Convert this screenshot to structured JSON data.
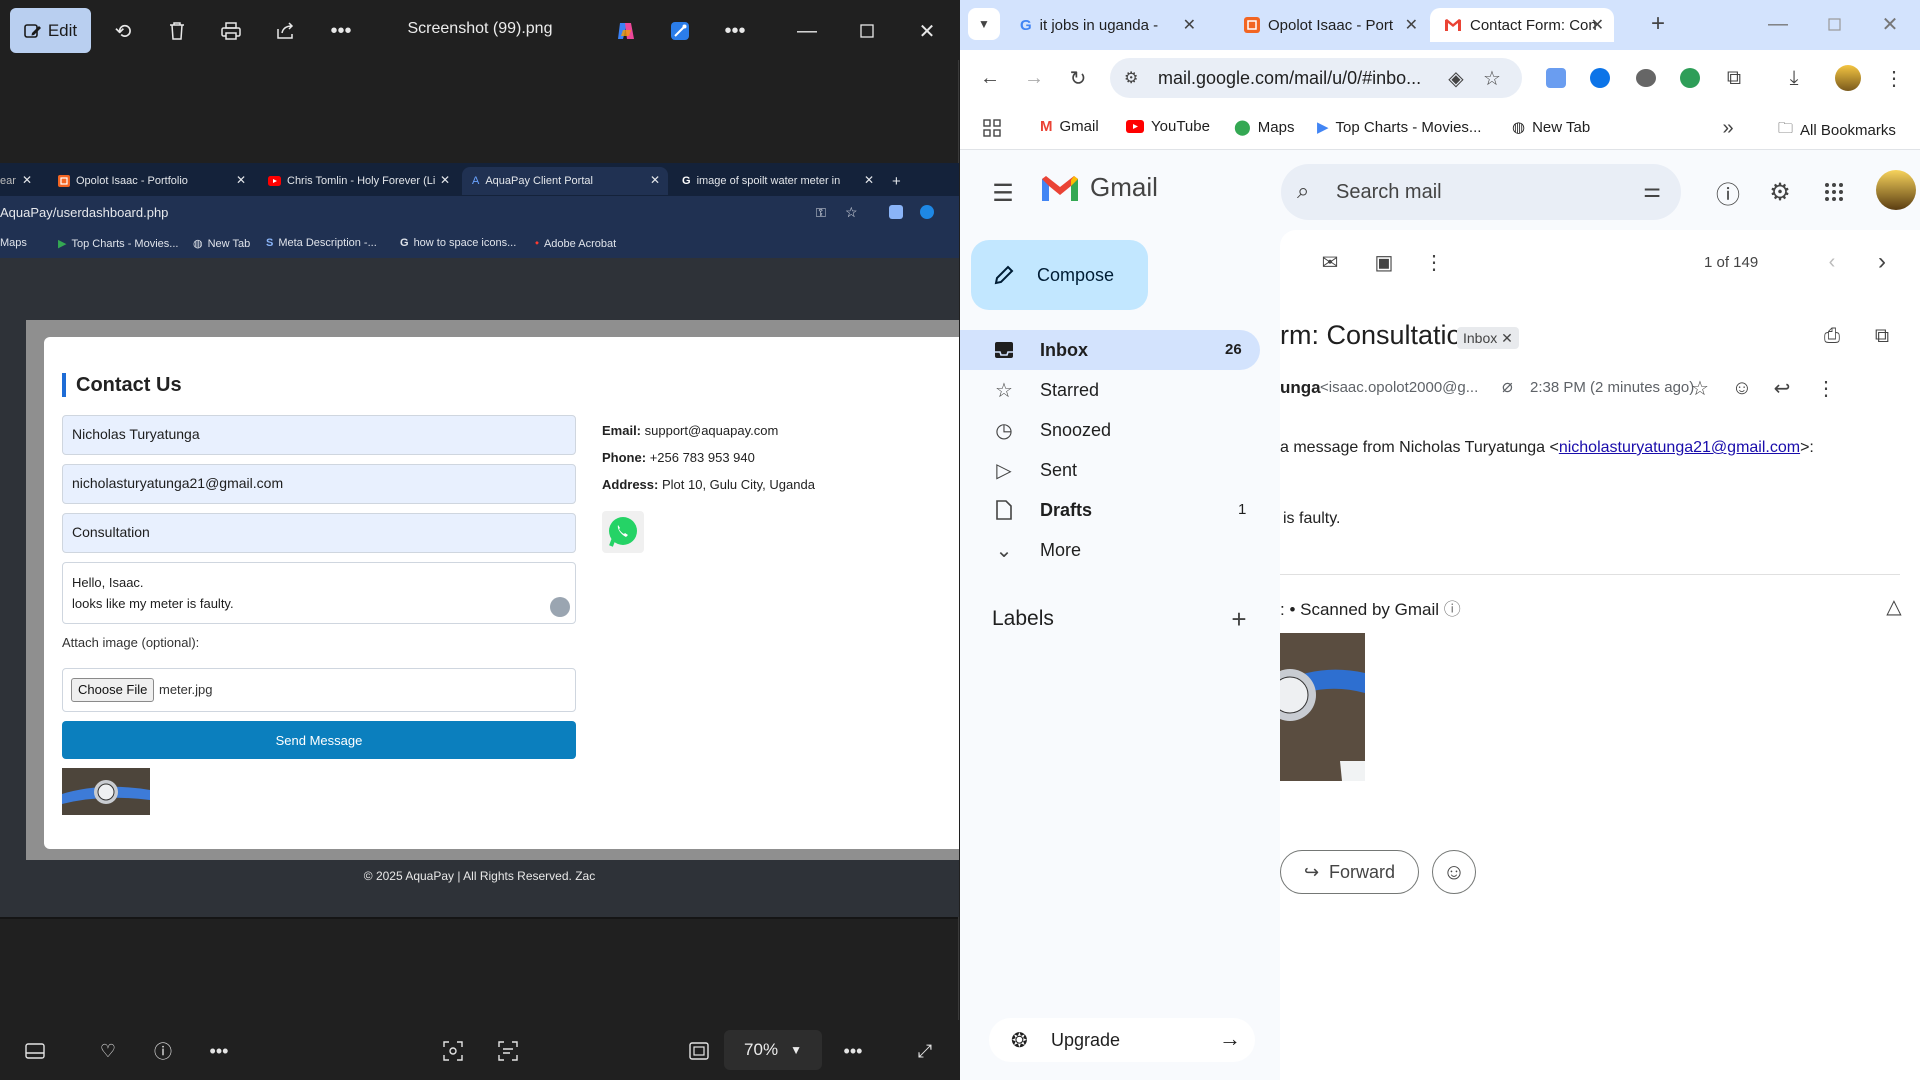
{
  "viewer": {
    "edit_label": "Edit",
    "title": "Screenshot (99).png",
    "zoom": "70%"
  },
  "shot": {
    "tabs": [
      {
        "label": "Opolot Isaac - Portfolio"
      },
      {
        "label": "Chris Tomlin - Holy Forever (Li"
      },
      {
        "label": "AquaPay Client Portal"
      },
      {
        "label": "image of spoilt water meter in"
      }
    ],
    "url": "AquaPay/userdashboard.php",
    "bookmarks": [
      "Maps",
      "Top Charts - Movies...",
      "New Tab",
      "Meta Description -...",
      "how to space icons...",
      "Adobe Acrobat"
    ],
    "contact": {
      "heading": "Contact Us",
      "name_value": "Nicholas Turyatunga",
      "email_value": "nicholasturyatunga21@gmail.com",
      "subject_value": "Consultation",
      "message_line1": "Hello, Isaac.",
      "message_line2": "looks like my meter is faulty.",
      "attach_label": "Attach image (optional):",
      "choose_file": "Choose File",
      "file_name": "meter.jpg",
      "send_label": "Send Message",
      "email_label": "Email:",
      "email_info": "support@aquapay.com",
      "phone_label": "Phone:",
      "phone_info": "+256 783 953 940",
      "address_label": "Address:",
      "address_info": "Plot 10, Gulu City, Uganda"
    },
    "footer": "© 2025 AquaPay | All Rights Reserved. Zac"
  },
  "chrome": {
    "tabs": [
      {
        "label": "it jobs in uganda -"
      },
      {
        "label": "Opolot Isaac - Port"
      },
      {
        "label": "Contact Form: Con"
      }
    ],
    "url": "mail.google.com/mail/u/0/#inbo...",
    "bookmarks": [
      "Gmail",
      "YouTube",
      "Maps",
      "Top Charts - Movies...",
      "New Tab"
    ],
    "all_bookmarks": "All Bookmarks"
  },
  "gmail": {
    "brand": "Gmail",
    "search_placeholder": "Search mail",
    "compose": "Compose",
    "nav": [
      {
        "label": "Inbox",
        "count": "26"
      },
      {
        "label": "Starred",
        "count": ""
      },
      {
        "label": "Snoozed",
        "count": ""
      },
      {
        "label": "Sent",
        "count": ""
      },
      {
        "label": "Drafts",
        "count": "1"
      },
      {
        "label": "More",
        "count": ""
      }
    ],
    "labels": "Labels",
    "upgrade": "Upgrade",
    "pagination": "1 of 149",
    "subject": "rm: Consultation",
    "badge": "Inbox",
    "sender_name": "unga",
    "sender_email": "<isaac.opolot2000@g...",
    "time": "2:38 PM (2 minutes ago)",
    "body_prefix": "a message from Nicholas Turyatunga <",
    "body_link": "nicholasturyatunga21@gmail.com",
    "body_suffix": ">:",
    "body_line": "is faulty.",
    "scanned": "Scanned by Gmail",
    "forward": "Forward"
  }
}
